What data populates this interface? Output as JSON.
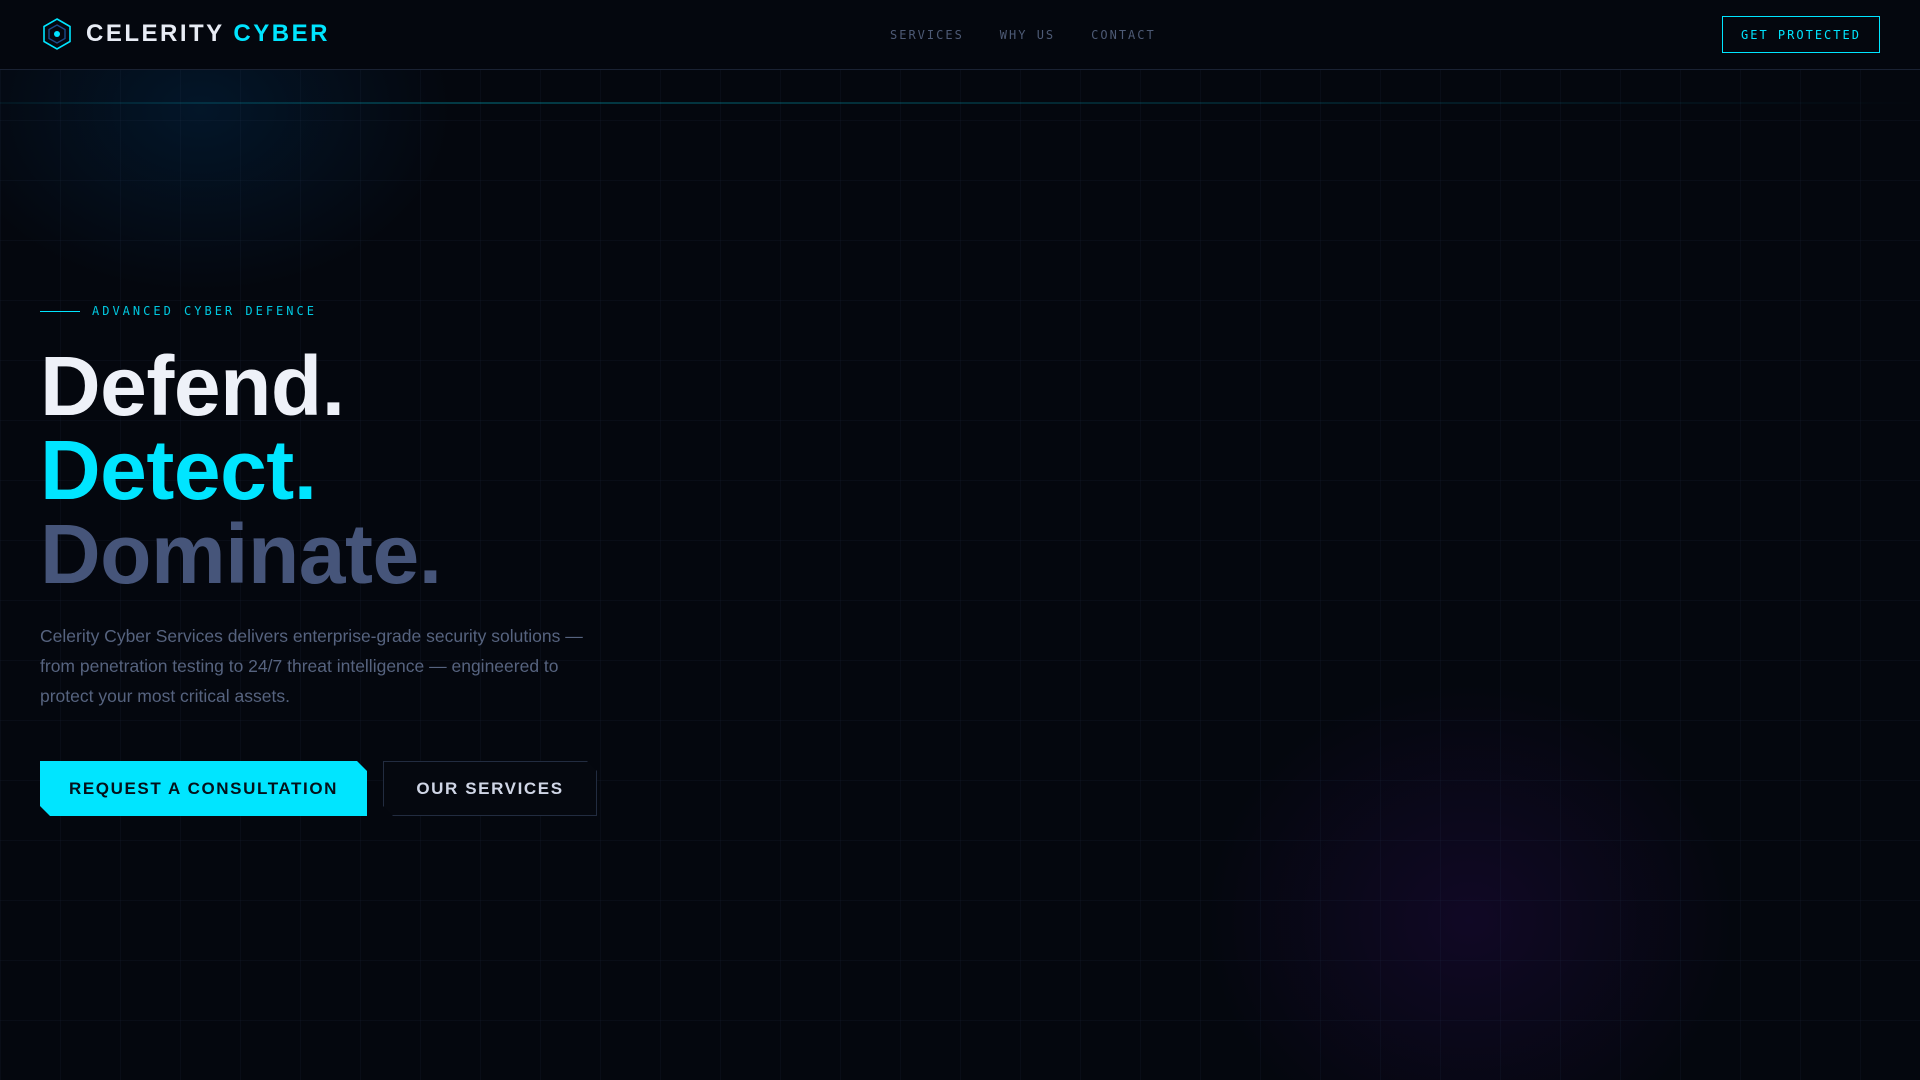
{
  "header": {
    "brand_part1": "CELERITY",
    "brand_part2": "CYBER",
    "nav": [
      {
        "label": "SERVICES"
      },
      {
        "label": "WHY US"
      },
      {
        "label": "CONTACT"
      }
    ],
    "cta_label": "GET PROTECTED"
  },
  "hero": {
    "eyebrow": "ADVANCED CYBER DEFENCE",
    "headline": [
      "Defend.",
      "Detect.",
      "Dominate."
    ],
    "lead": "Celerity Cyber Services delivers enterprise-grade security solutions — from penetration testing to 24/7 threat intelligence — engineered to protect your most critical assets.",
    "primary_button": "REQUEST A CONSULTATION",
    "secondary_button": "OUR SERVICES"
  },
  "colors": {
    "accent": "#00e5ff",
    "background": "#04070e",
    "muted": "#46557a"
  }
}
